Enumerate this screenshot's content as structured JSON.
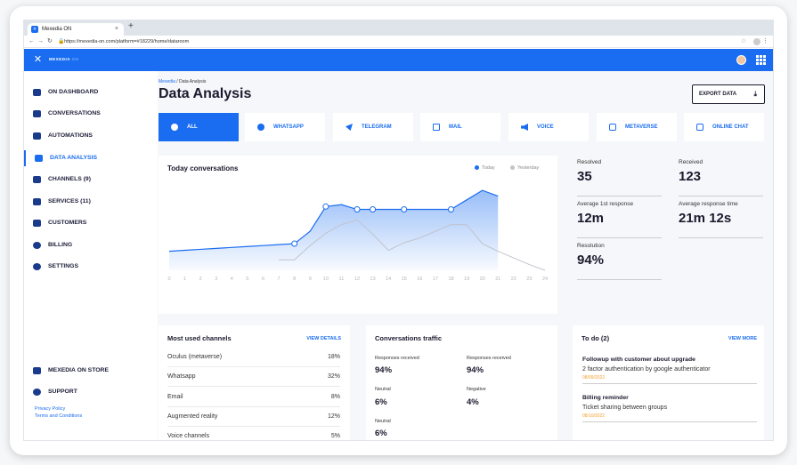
{
  "browser": {
    "tab_title": "Mexedia ON",
    "url": "https://mexedia-on.com/platform=#18229/home/dataroom"
  },
  "app": {
    "brand": "MEXEDIA",
    "brand_suffix": "ON",
    "accent": "#1a6df0"
  },
  "sidebar": {
    "items": [
      {
        "label": "ON DASHBOARD",
        "icon": "home-icon"
      },
      {
        "label": "CONVERSATIONS",
        "icon": "chat-icon"
      },
      {
        "label": "AUTOMATIONS",
        "icon": "flow-icon"
      },
      {
        "label": "DATA ANALYSIS",
        "icon": "bar-chart-icon"
      },
      {
        "label": "CHANNELS (9)",
        "icon": "layers-icon"
      },
      {
        "label": "SERVICES (11)",
        "icon": "services-icon"
      },
      {
        "label": "CUSTOMERS",
        "icon": "users-icon"
      },
      {
        "label": "BILLING",
        "icon": "dollar-icon"
      },
      {
        "label": "SETTINGS",
        "icon": "gear-icon"
      }
    ],
    "store": "MEXEDIA ON STORE",
    "support": "SUPPORT",
    "privacy": "Privacy Policy",
    "terms": "Terms and Conditions"
  },
  "header": {
    "crumb_root": "Mexedia",
    "crumb_sep": "/",
    "crumb_current": "Data Analysis",
    "title": "Data Analysis",
    "export_label": "EXPORT DATA"
  },
  "channel_tabs": [
    "ALL",
    "WHATSAPP",
    "TELEGRAM",
    "MAIL",
    "VOICE",
    "METAVERSE",
    "ONLINE CHAT"
  ],
  "chart": {
    "title": "Today conversations",
    "legend_today": "Today",
    "legend_yesterday": "Yesterday",
    "color_today": "#1a6df0",
    "color_yesterday": "#c0c4cc"
  },
  "chart_data": {
    "type": "line",
    "x": [
      "0",
      "1",
      "2",
      "3",
      "4",
      "5",
      "6",
      "7",
      "8",
      "9",
      "10",
      "11",
      "12",
      "13",
      "14",
      "15",
      "16",
      "17",
      "18",
      "19",
      "20",
      "21",
      "22",
      "23",
      "24"
    ],
    "ylim": [
      0,
      100
    ],
    "series": [
      {
        "name": "Today",
        "values": [
          20,
          21,
          22,
          23,
          24,
          25,
          26,
          27,
          28,
          41,
          67,
          69,
          64,
          64,
          64,
          64,
          64,
          64,
          64,
          74,
          84,
          78,
          null,
          null,
          null
        ]
      },
      {
        "name": "Yesterday",
        "values": [
          null,
          null,
          null,
          null,
          null,
          null,
          null,
          11,
          11,
          26,
          39,
          48,
          53,
          38,
          21,
          29,
          34,
          41,
          48,
          48,
          28,
          20,
          13,
          6,
          0
        ]
      }
    ]
  },
  "stats": [
    {
      "label": "Resolved",
      "value": "35"
    },
    {
      "label": "Received",
      "value": "123"
    },
    {
      "label": "Average 1st response",
      "value": "12m"
    },
    {
      "label": "Average response time",
      "value": "21m 12s"
    },
    {
      "label": "Resolution",
      "value": "94%"
    }
  ],
  "channels_card": {
    "title": "Most used channels",
    "link": "VIEW DETAILS",
    "rows": [
      {
        "name": "Oculus (metaverse)",
        "value": "18%"
      },
      {
        "name": "Whatsapp",
        "value": "32%"
      },
      {
        "name": "Email",
        "value": "8%"
      },
      {
        "name": "Augmented reality",
        "value": "12%"
      },
      {
        "name": "Voice channels",
        "value": "5%"
      }
    ]
  },
  "traffic_card": {
    "title": "Conversations  traffic",
    "items": [
      {
        "label": "Responses received",
        "value": "94%"
      },
      {
        "label": "Responses received",
        "value": "94%"
      },
      {
        "label": "Neutral",
        "value": "6%"
      },
      {
        "label": "Negative",
        "value": "4%"
      },
      {
        "label": "Neutral",
        "value": "6%"
      }
    ]
  },
  "todo_card": {
    "title": "To do (2)",
    "link": "VIEW MORE",
    "items": [
      {
        "title": "Followup with customer about upgrade",
        "desc": "2  factor authentication by google authenticator",
        "date": "08/09/2022"
      },
      {
        "title": "Billing reminder",
        "desc": "Ticket sharing between groups",
        "date": "08/10/2022"
      }
    ]
  }
}
